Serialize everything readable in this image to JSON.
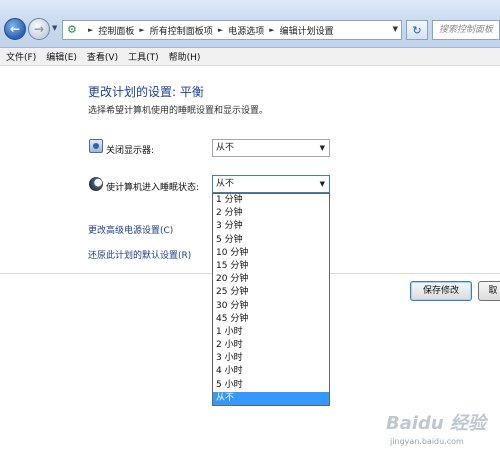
{
  "address_bar": {
    "breadcrumbs": [
      "控制面板",
      "所有控制面板项",
      "电源选项",
      "编辑计划设置"
    ],
    "search_placeholder": "搜索控制面板"
  },
  "menu": [
    "文件(F)",
    "编辑(E)",
    "查看(V)",
    "工具(T)",
    "帮助(H)"
  ],
  "page": {
    "title": "更改计划的设置: 平衡",
    "subtitle": "选择希望计算机使用的睡眠设置和显示设置。"
  },
  "settings": {
    "display_off_label": "关闭显示器:",
    "display_off_value": "从不",
    "sleep_label": "使计算机进入睡眠状态:",
    "sleep_value": "从不"
  },
  "dropdown_options": [
    "1 分钟",
    "2 分钟",
    "3 分钟",
    "5 分钟",
    "10 分钟",
    "15 分钟",
    "20 分钟",
    "25 分钟",
    "30 分钟",
    "45 分钟",
    "1 小时",
    "2 小时",
    "3 小时",
    "4 小时",
    "5 小时",
    "从不"
  ],
  "dropdown_selected_index": 15,
  "links": {
    "advanced": "更改高级电源设置(C)",
    "restore": "还原此计划的默认设置(R)"
  },
  "buttons": {
    "save": "保存修改",
    "cancel": "取"
  },
  "watermark": {
    "logo": "Baidu 经验",
    "url": "jingyan.baidu.com"
  }
}
